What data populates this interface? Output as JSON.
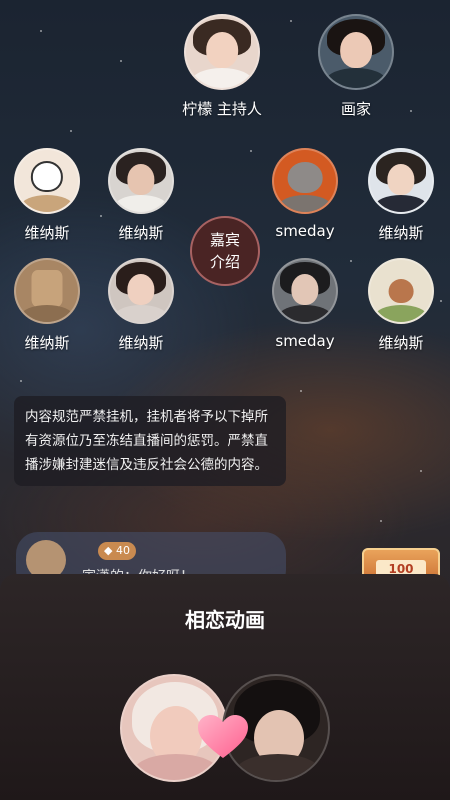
{
  "guests": {
    "host": {
      "name": "柠檬 主持人",
      "avatar": "host-avatar"
    },
    "painter": {
      "name": "画家",
      "avatar": "painter-avatar"
    },
    "left_top_1": {
      "name": "维纳斯"
    },
    "left_top_2": {
      "name": "维纳斯"
    },
    "right_top_1": {
      "name": "smeday"
    },
    "right_top_2": {
      "name": "维纳斯"
    },
    "left_bot_1": {
      "name": "维纳斯"
    },
    "left_bot_2": {
      "name": "维纳斯"
    },
    "right_bot_1": {
      "name": "smeday"
    },
    "right_bot_2": {
      "name": "维纳斯"
    }
  },
  "center_button": {
    "line1": "嘉宾",
    "line2": "介绍"
  },
  "notice": {
    "text": "内容规范严禁挂机，挂机者将予以下掉所有资源位乃至冻结直播间的惩罚。严禁直播涉嫌封建迷信及违反社会公德的内容。"
  },
  "chat": {
    "badge": "40",
    "text": "寅潇的：你好呀！"
  },
  "gift": {
    "number": "100"
  },
  "sheet": {
    "title": "相恋动画"
  },
  "colors": {
    "accent": "#c98a50",
    "center_bg": "#4a2424",
    "sheet_bg": "#2d2627"
  }
}
